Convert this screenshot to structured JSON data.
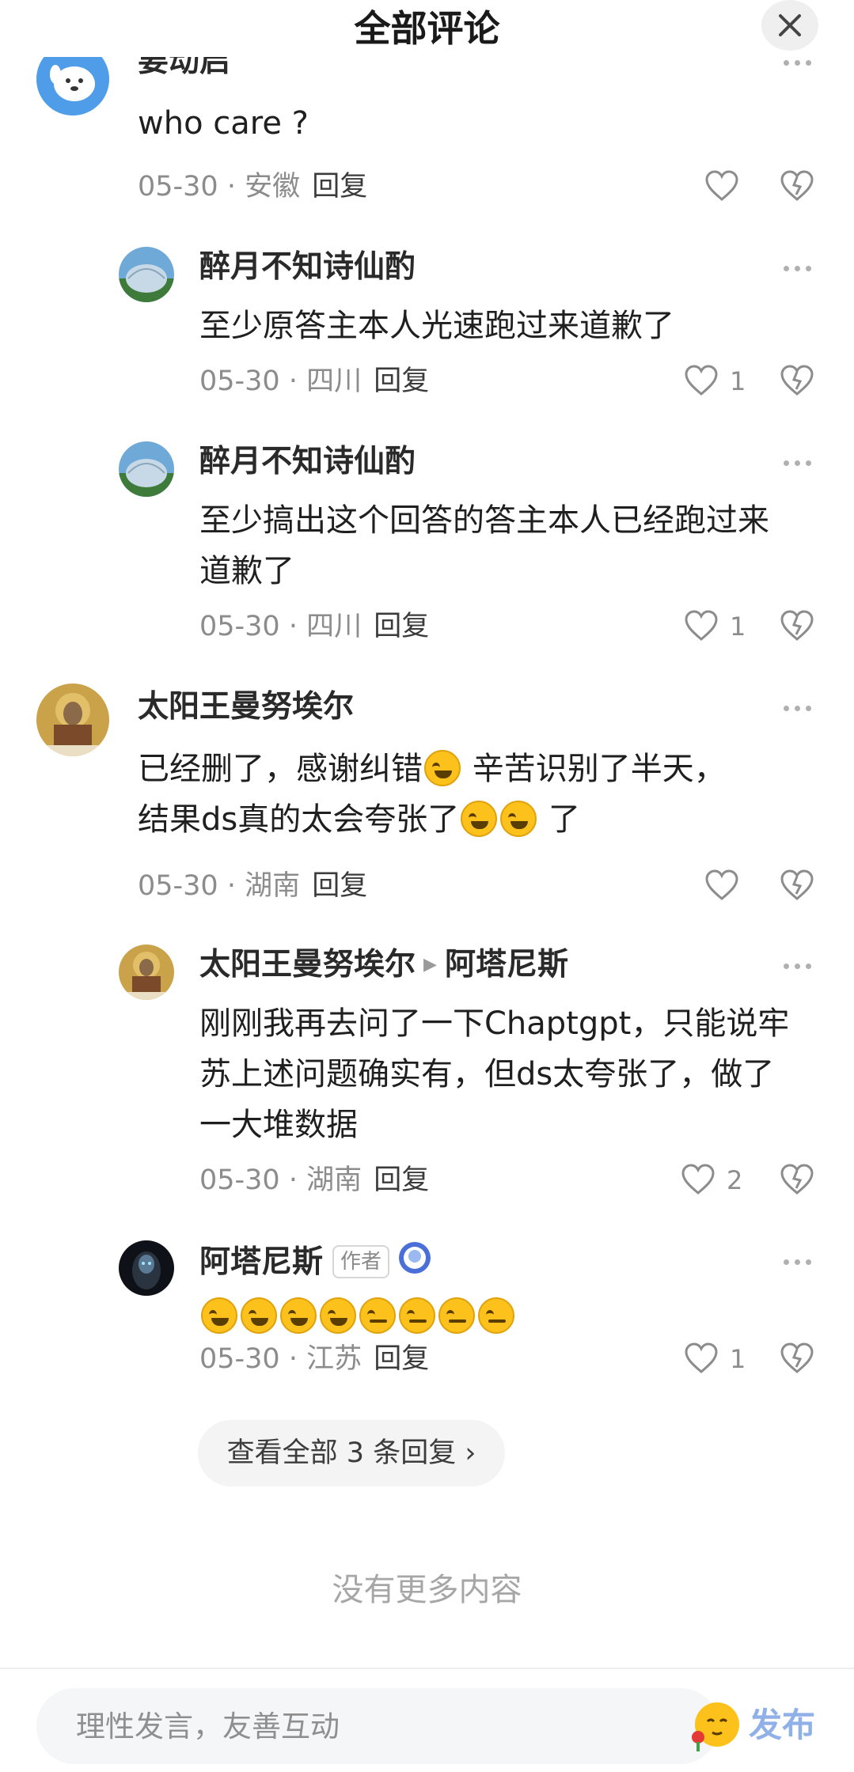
{
  "header": {
    "title": "全部评论"
  },
  "comments": [
    {
      "name": "要动启",
      "content": "who care ?",
      "date": "05-30",
      "location": "安徽",
      "reply": "回复",
      "likes": ""
    },
    {
      "name": "醉月不知诗仙酌",
      "content": "至少原答主本人光速跑过来道歉了",
      "date": "05-30",
      "location": "四川",
      "reply": "回复",
      "likes": "1"
    },
    {
      "name": "醉月不知诗仙酌",
      "content_line1": "至少搞出这个回答的答主本人已经跑过来",
      "content_line2": "道歉了",
      "date": "05-30",
      "location": "四川",
      "reply": "回复",
      "likes": "1"
    },
    {
      "name": "太阳王曼努埃尔",
      "content_line1_a": "已经删了，感谢纠错",
      "content_line1_b": "辛苦识别了半天，",
      "content_line2_a": "结果ds真的太会夸张了",
      "content_line2_b": "了",
      "date": "05-30",
      "location": "湖南",
      "reply": "回复",
      "likes": ""
    },
    {
      "name": "太阳王曼努埃尔",
      "reply_to": "阿塔尼斯",
      "content_line1": "刚刚我再去问了一下Chaptgpt，只能说牢",
      "content_line2": "苏上述问题确实有，但ds太夸张了，做了",
      "content_line3": "一大堆数据",
      "date": "05-30",
      "location": "湖南",
      "reply": "回复",
      "likes": "2"
    },
    {
      "name": "阿塔尼斯",
      "author_tag": "作者",
      "date": "05-30",
      "location": "江苏",
      "reply": "回复",
      "likes": "1"
    }
  ],
  "view_all": "查看全部 3 条回复 ›",
  "no_more": "没有更多内容",
  "bottom_bar": {
    "placeholder": "理性发言，友善互动",
    "publish": "发布"
  },
  "icons": {
    "close": "close-icon",
    "more": "more-dots-icon",
    "like": "heart-icon",
    "dislike": "broken-heart-icon",
    "sticker": "emoji-sticker-icon"
  },
  "colors": {
    "publish": "#8fb1e8",
    "meta": "#8c8c8c"
  }
}
